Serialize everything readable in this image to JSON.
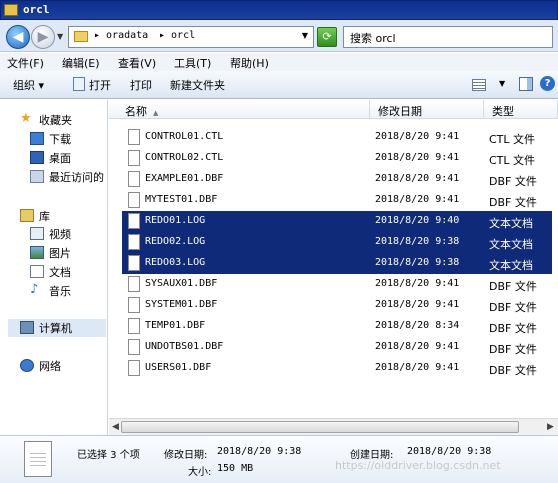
{
  "window": {
    "title": "orcl"
  },
  "address": {
    "crumbs": [
      "▸ oradata",
      "▸ orcl"
    ],
    "search_placeholder": "搜索 orcl"
  },
  "menu": [
    "文件(F)",
    "编辑(E)",
    "查看(V)",
    "工具(T)",
    "帮助(H)"
  ],
  "toolbar": {
    "organize": "组织 ▾",
    "open": "打开",
    "print": "打印",
    "new_folder": "新建文件夹"
  },
  "nav": {
    "favorites": "收藏夹",
    "downloads": "下载",
    "desktop": "桌面",
    "recent": "最近访问的",
    "libraries": "库",
    "videos": "视频",
    "pictures": "图片",
    "documents": "文档",
    "music": "音乐",
    "computer": "计算机",
    "network": "网络"
  },
  "columns": {
    "name": "名称",
    "date": "修改日期",
    "type": "类型"
  },
  "files": [
    {
      "name": "CONTROL01.CTL",
      "date": "2018/8/20 9:41",
      "type": "CTL 文件",
      "selected": false
    },
    {
      "name": "CONTROL02.CTL",
      "date": "2018/8/20 9:41",
      "type": "CTL 文件",
      "selected": false
    },
    {
      "name": "EXAMPLE01.DBF",
      "date": "2018/8/20 9:41",
      "type": "DBF 文件",
      "selected": false
    },
    {
      "name": "MYTEST01.DBF",
      "date": "2018/8/20 9:41",
      "type": "DBF 文件",
      "selected": false
    },
    {
      "name": "REDO01.LOG",
      "date": "2018/8/20 9:40",
      "type": "文本文档",
      "selected": true
    },
    {
      "name": "REDO02.LOG",
      "date": "2018/8/20 9:38",
      "type": "文本文档",
      "selected": true
    },
    {
      "name": "REDO03.LOG",
      "date": "2018/8/20 9:38",
      "type": "文本文档",
      "selected": true
    },
    {
      "name": "SYSAUX01.DBF",
      "date": "2018/8/20 9:41",
      "type": "DBF 文件",
      "selected": false
    },
    {
      "name": "SYSTEM01.DBF",
      "date": "2018/8/20 9:41",
      "type": "DBF 文件",
      "selected": false
    },
    {
      "name": "TEMP01.DBF",
      "date": "2018/8/20 8:34",
      "type": "DBF 文件",
      "selected": false
    },
    {
      "name": "UNDOTBS01.DBF",
      "date": "2018/8/20 9:41",
      "type": "DBF 文件",
      "selected": false
    },
    {
      "name": "USERS01.DBF",
      "date": "2018/8/20 9:41",
      "type": "DBF 文件",
      "selected": false
    }
  ],
  "details": {
    "selected": "已选择 3 个项",
    "modified_label": "修改日期:",
    "modified_value": "2018/8/20 9:38",
    "created_label": "创建日期:",
    "created_value": "2018/8/20 9:38",
    "size_label": "大小:",
    "size_value": "150 MB"
  },
  "watermark": "https://olddriver.blog.csdn.net",
  "colors": {
    "selection": "#0f2a78",
    "title_bar": "#0e2f8c"
  }
}
